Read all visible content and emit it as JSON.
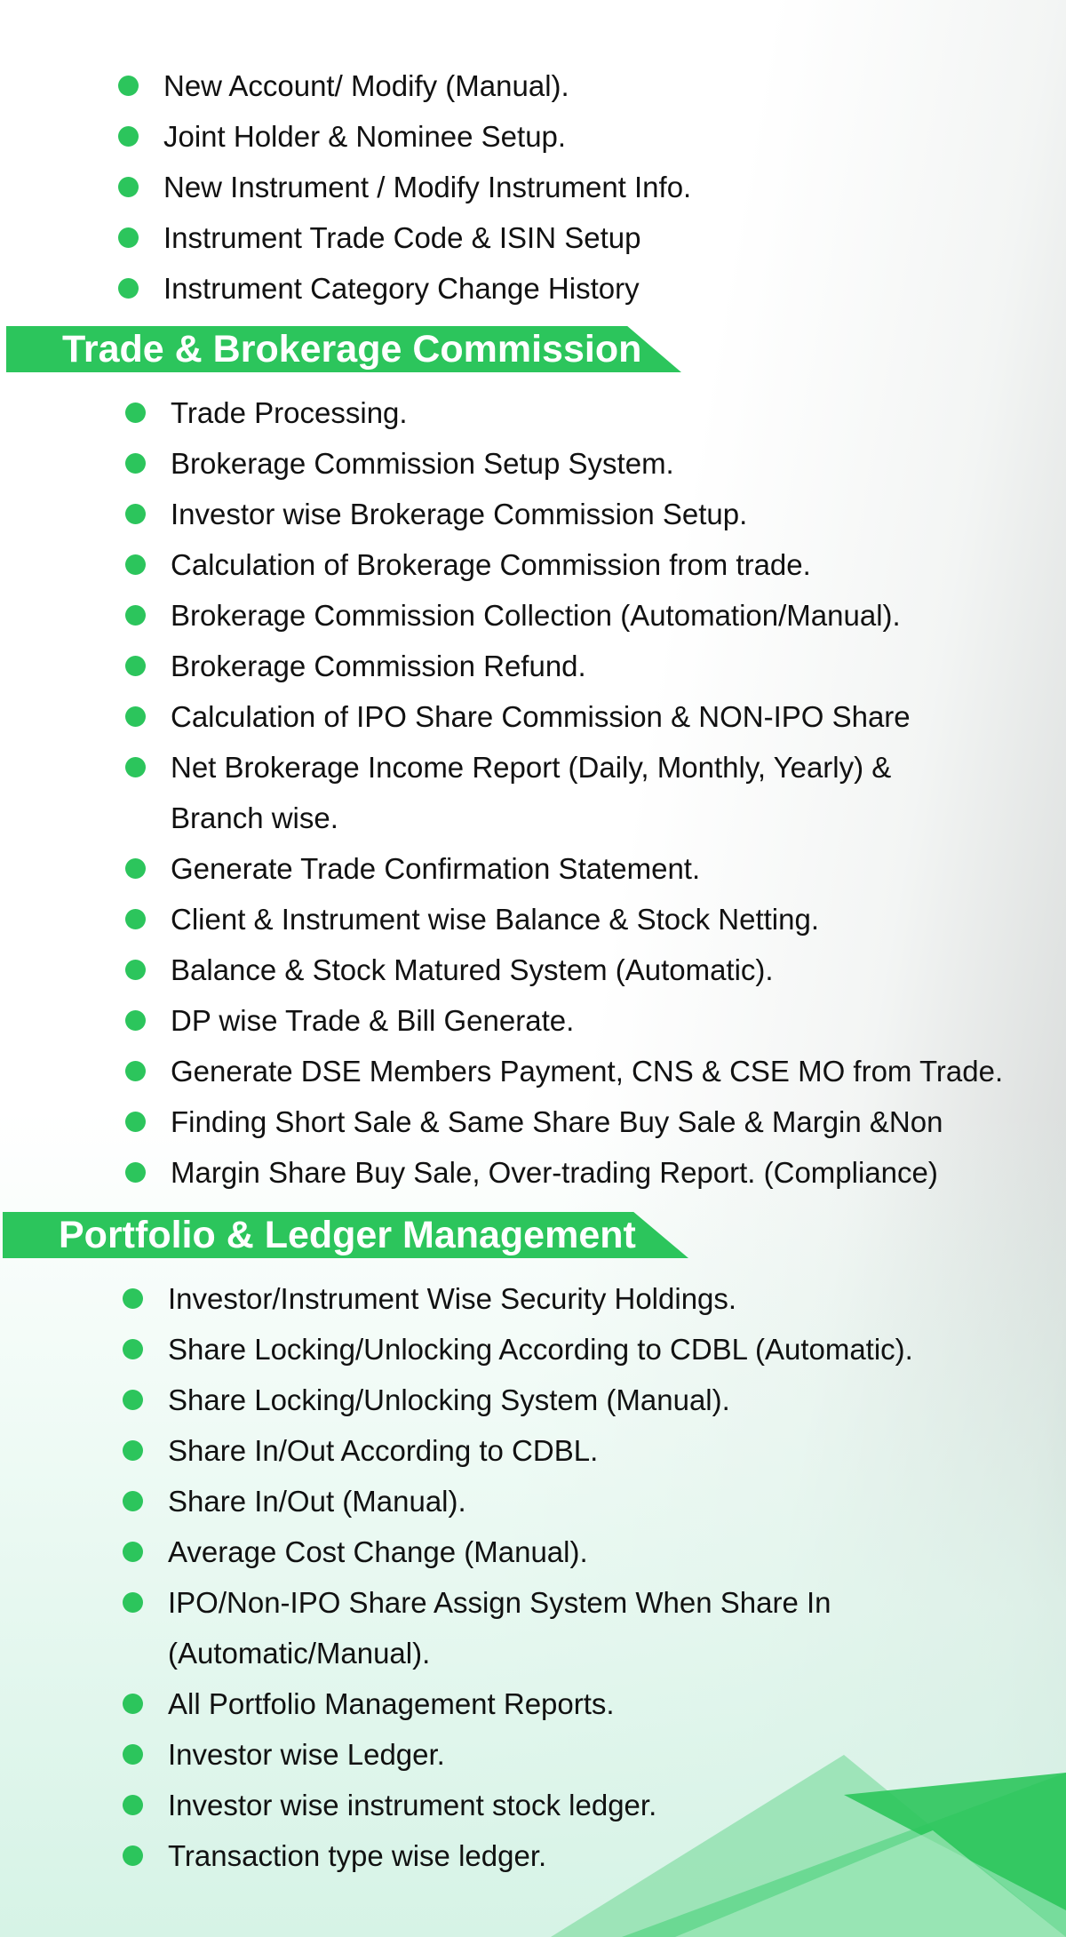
{
  "intro_items": [
    "New Account/ Modify (Manual).",
    "Joint Holder & Nominee Setup.",
    "New Instrument / Modify Instrument Info.",
    "Instrument Trade Code & ISIN Setup",
    "Instrument Category Change History"
  ],
  "trade_section": {
    "title": "Trade & Brokerage Commission",
    "items": [
      "Trade Processing.",
      "Brokerage Commission Setup System.",
      "Investor wise Brokerage Commission Setup.",
      "Calculation of Brokerage Commission from trade.",
      "Brokerage Commission Collection (Automation/Manual).",
      "Brokerage Commission Refund.",
      "Calculation of IPO Share Commission & NON-IPO Share",
      "Net Brokerage Income Report (Daily, Monthly, Yearly) &",
      "Branch wise.",
      "Generate Trade Confirmation Statement.",
      "Client & Instrument wise Balance & Stock Netting.",
      "Balance & Stock Matured System (Automatic).",
      "DP wise Trade & Bill Generate.",
      "Generate DSE Members Payment, CNS & CSE MO from Trade.",
      "Finding Short Sale & Same Share Buy Sale & Margin &Non",
      "Margin Share Buy Sale, Over-trading Report. (Compliance)"
    ]
  },
  "portfolio_section": {
    "title": "Portfolio & Ledger Management",
    "items": [
      "Investor/Instrument Wise Security Holdings.",
      "Share Locking/Unlocking According to CDBL (Automatic).",
      "Share Locking/Unlocking System (Manual).",
      "Share In/Out According to CDBL.",
      "Share In/Out (Manual).",
      "Average Cost Change (Manual).",
      "IPO/Non-IPO Share Assign System When Share In",
      "(Automatic/Manual).",
      "All Portfolio Management Reports.",
      "Investor wise Ledger.",
      "Investor wise instrument stock ledger.",
      "Transaction type wise  ledger."
    ]
  },
  "colors": {
    "accent_green": "#2cc55c",
    "text": "#111111"
  }
}
